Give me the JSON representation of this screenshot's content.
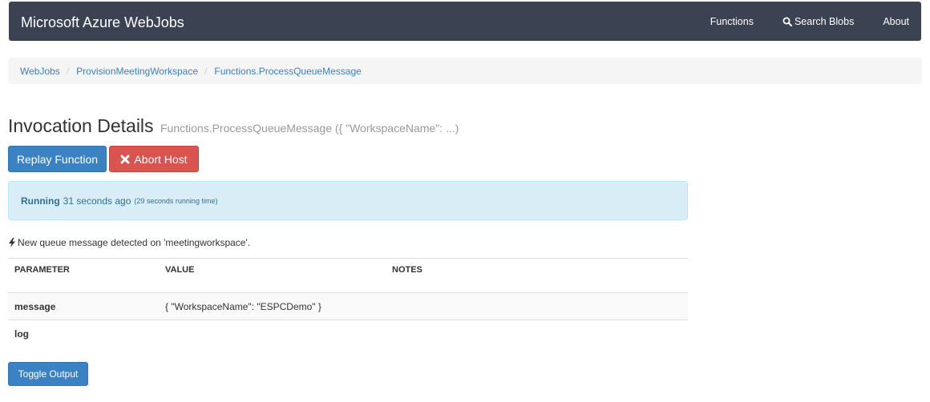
{
  "navbar": {
    "brand": "Microsoft Azure WebJobs",
    "links": [
      {
        "label": "Functions"
      },
      {
        "label": "Search Blobs",
        "icon": "search-icon"
      },
      {
        "label": "About"
      }
    ]
  },
  "breadcrumb": [
    "WebJobs",
    "ProvisionMeetingWorkspace",
    "Functions.ProcessQueueMessage"
  ],
  "header": {
    "title": "Invocation Details",
    "subtitle": "Functions.ProcessQueueMessage ({ \"WorkspaceName\": ...)"
  },
  "actions": {
    "replay_label": "Replay Function",
    "abort_label": "Abort Host"
  },
  "status": {
    "state": "Running",
    "when": "31 seconds ago",
    "running_time": "(29 seconds running time)"
  },
  "trigger": {
    "text": "New queue message detected on 'meetingworkspace'."
  },
  "table": {
    "headers": [
      "PARAMETER",
      "VALUE",
      "NOTES"
    ],
    "rows": [
      {
        "parameter": "message",
        "value": "{ \"WorkspaceName\": \"ESPCDemo\" }",
        "notes": ""
      },
      {
        "parameter": "log",
        "value": "",
        "notes": ""
      }
    ]
  },
  "footer": {
    "toggle_label": "Toggle Output"
  },
  "colors": {
    "navbar_bg": "#3b4251",
    "primary": "#3b82c4",
    "danger": "#d9534f",
    "info_bg": "#d9edf7",
    "info_text": "#31708f",
    "link": "#3b7fc1"
  }
}
